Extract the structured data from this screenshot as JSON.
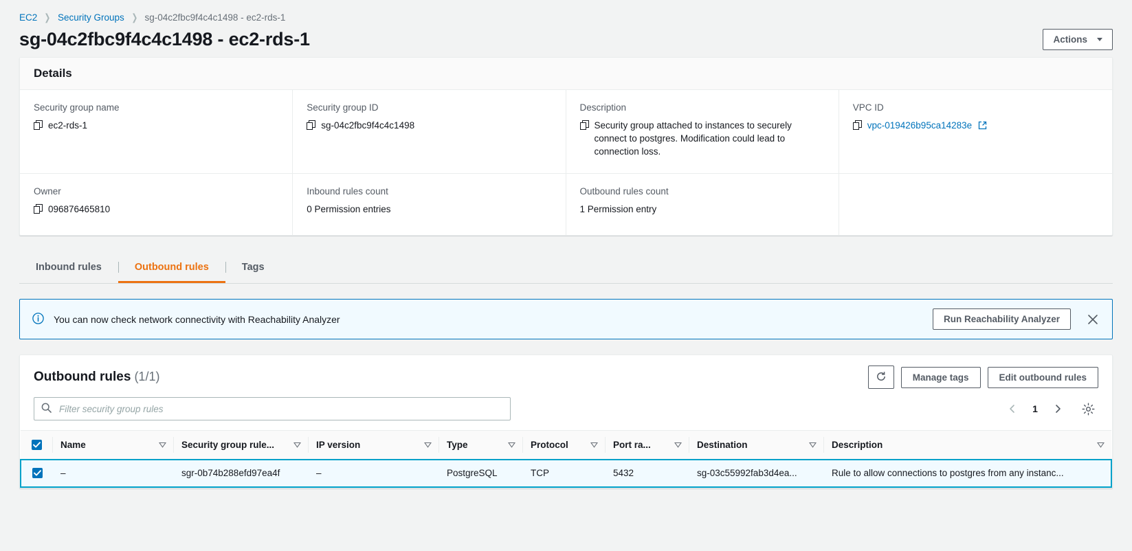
{
  "breadcrumb": {
    "items": [
      {
        "label": "EC2",
        "type": "link"
      },
      {
        "label": "Security Groups",
        "type": "link"
      },
      {
        "label": "sg-04c2fbc9f4c4c1498 - ec2-rds-1",
        "type": "current"
      }
    ]
  },
  "header": {
    "title": "sg-04c2fbc9f4c4c1498 - ec2-rds-1",
    "actions_label": "Actions"
  },
  "details": {
    "heading": "Details",
    "fields": [
      {
        "label": "Security group name",
        "value": "ec2-rds-1",
        "copyable": true
      },
      {
        "label": "Security group ID",
        "value": "sg-04c2fbc9f4c4c1498",
        "copyable": true
      },
      {
        "label": "Description",
        "value": "Security group attached to instances to securely connect to postgres. Modification could lead to connection loss.",
        "copyable": true
      },
      {
        "label": "VPC ID",
        "value": "vpc-019426b95ca14283e",
        "copyable": true,
        "is_link": true,
        "external": true
      },
      {
        "label": "Owner",
        "value": "096876465810",
        "copyable": true
      },
      {
        "label": "Inbound rules count",
        "value": "0 Permission entries",
        "copyable": false
      },
      {
        "label": "Outbound rules count",
        "value": "1 Permission entry",
        "copyable": false
      }
    ]
  },
  "tabs": [
    {
      "label": "Inbound rules",
      "active": false
    },
    {
      "label": "Outbound rules",
      "active": true
    },
    {
      "label": "Tags",
      "active": false
    }
  ],
  "flashbar": {
    "icon": "info-icon",
    "message": "You can now check network connectivity with Reachability Analyzer",
    "action_label": "Run Reachability Analyzer",
    "dismiss_icon": "close-icon"
  },
  "table": {
    "title": "Outbound rules",
    "count": "(1/1)",
    "refresh_icon": "refresh-icon",
    "manage_tags_label": "Manage tags",
    "edit_rules_label": "Edit outbound rules",
    "search": {
      "icon": "search-icon",
      "placeholder": "Filter security group rules",
      "value": ""
    },
    "pagination": {
      "prev_icon": "chevron-left-icon",
      "page": "1",
      "next_icon": "chevron-right-icon",
      "settings_icon": "gear-icon"
    },
    "columns": [
      {
        "label": "Name",
        "sortable": true
      },
      {
        "label": "Security group rule...",
        "sortable": true
      },
      {
        "label": "IP version",
        "sortable": true
      },
      {
        "label": "Type",
        "sortable": true
      },
      {
        "label": "Protocol",
        "sortable": true
      },
      {
        "label": "Port ra...",
        "sortable": true
      },
      {
        "label": "Destination",
        "sortable": true
      },
      {
        "label": "Description",
        "sortable": true
      }
    ],
    "rows": [
      {
        "selected": true,
        "name": "–",
        "rule_id": "sgr-0b74b288efd97ea4f",
        "ip_version": "–",
        "type": "PostgreSQL",
        "protocol": "TCP",
        "port_range": "5432",
        "destination": "sg-03c55992fab3d4ea...",
        "description": "Rule to allow connections to postgres from any instanc..."
      }
    ]
  },
  "colors": {
    "accent_orange": "#ec7211",
    "link_blue": "#0073bb",
    "selected_border": "#00a1c9",
    "selected_bg": "#f1faff",
    "page_bg": "#f2f3f3"
  }
}
